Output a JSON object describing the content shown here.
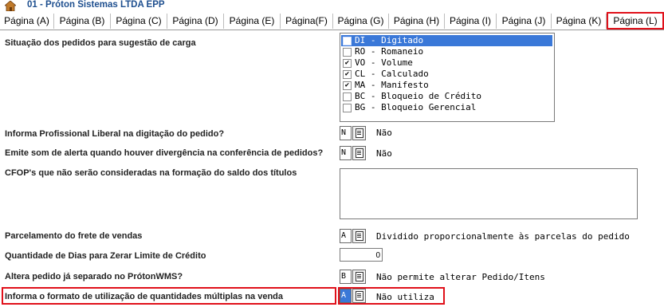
{
  "header": {
    "company": "01 - Próton Sistemas LTDA EPP",
    "icon": "house-icon"
  },
  "tabs": [
    {
      "label": "Página (A)"
    },
    {
      "label": "Página (B)"
    },
    {
      "label": "Página (C)"
    },
    {
      "label": "Página (D)"
    },
    {
      "label": "Página (E)"
    },
    {
      "label": "Página(F)"
    },
    {
      "label": "Página (G)"
    },
    {
      "label": "Página (H)"
    },
    {
      "label": "Página (I)"
    },
    {
      "label": "Página (J)"
    },
    {
      "label": "Página (K)"
    },
    {
      "label": "Página (L)"
    }
  ],
  "active_tab": "Página (L)",
  "fields": {
    "situacao": {
      "label": "Situação dos pedidos para sugestão de carga",
      "options": [
        {
          "text": "DI - Digitado",
          "checked": false,
          "selected": true
        },
        {
          "text": "RO - Romaneio",
          "checked": false,
          "selected": false
        },
        {
          "text": "VO - Volume",
          "checked": true,
          "selected": false
        },
        {
          "text": "CL - Calculado",
          "checked": true,
          "selected": false
        },
        {
          "text": "MA - Manifesto",
          "checked": true,
          "selected": false
        },
        {
          "text": "BC - Bloqueio de Crédito",
          "checked": false,
          "selected": false
        },
        {
          "text": "BG - Bloqueio Gerencial",
          "checked": false,
          "selected": false
        }
      ]
    },
    "profissional": {
      "label": "Informa Profissional Liberal na digitação do pedido?",
      "code": "N",
      "desc": "Não"
    },
    "som_alerta": {
      "label": "Emite som de alerta quando houver divergência na conferência de pedidos?",
      "code": "N",
      "desc": "Não"
    },
    "cfop": {
      "label": "CFOP's que não serão consideradas na formação do saldo dos títulos",
      "value": ""
    },
    "frete": {
      "label": "Parcelamento do frete de vendas",
      "code": "A",
      "desc": "Dividido proporcionalmente às parcelas do pedido"
    },
    "dias_limite": {
      "label": "Quantidade de Dias para Zerar Limite de Crédito",
      "value": "0"
    },
    "altera_pedido": {
      "label": "Altera pedido já separado no PrótonWMS?",
      "code": "B",
      "desc": "Não permite alterar Pedido/Itens"
    },
    "qtd_multiplas": {
      "label": "Informa o formato de utilização de quantidades múltiplas na venda",
      "code": "A",
      "desc": "Não utiliza"
    }
  },
  "colors": {
    "highlight": "#e0101a",
    "selection": "#3a78d8",
    "title": "#1e4f8f"
  }
}
